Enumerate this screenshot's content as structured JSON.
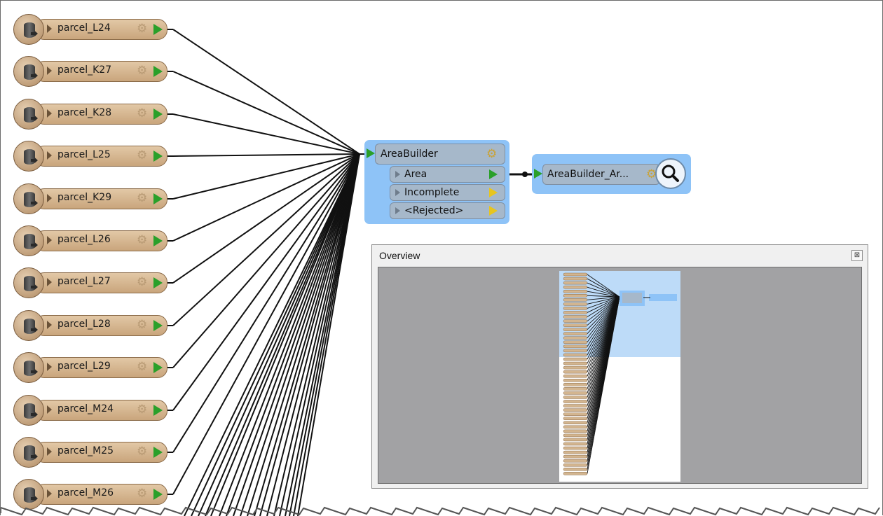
{
  "readers": [
    {
      "label": "parcel_L24"
    },
    {
      "label": "parcel_K27"
    },
    {
      "label": "parcel_K28"
    },
    {
      "label": "parcel_L25"
    },
    {
      "label": "parcel_K29"
    },
    {
      "label": "parcel_L26"
    },
    {
      "label": "parcel_L27"
    },
    {
      "label": "parcel_L28"
    },
    {
      "label": "parcel_L29"
    },
    {
      "label": "parcel_M24"
    },
    {
      "label": "parcel_M25"
    },
    {
      "label": "parcel_M26"
    }
  ],
  "transformer": {
    "name": "AreaBuilder",
    "ports": [
      {
        "label": "Area",
        "status": "connected"
      },
      {
        "label": "Incomplete",
        "status": "unconnected"
      },
      {
        "label": "<Rejected>",
        "status": "unconnected"
      }
    ]
  },
  "inspector": {
    "name": "AreaBuilder_Ar..."
  },
  "overview": {
    "title": "Overview",
    "close_glyph": "⊠"
  },
  "icons": {
    "reader": "database-reader-icon",
    "gear": "gear-icon",
    "inspect": "magnifier-icon",
    "expand": "triangle-right-icon",
    "output_connected": "green-port-icon",
    "output_unconnected": "yellow-port-icon"
  },
  "colors": {
    "reader_fill": "#d9bb94",
    "selection": "#8ec3f7",
    "transformer_fill": "#a6b8ca",
    "port_green": "#2aa02a",
    "port_yellow": "#e7c51f",
    "overview_bg": "#a2a2a4"
  }
}
